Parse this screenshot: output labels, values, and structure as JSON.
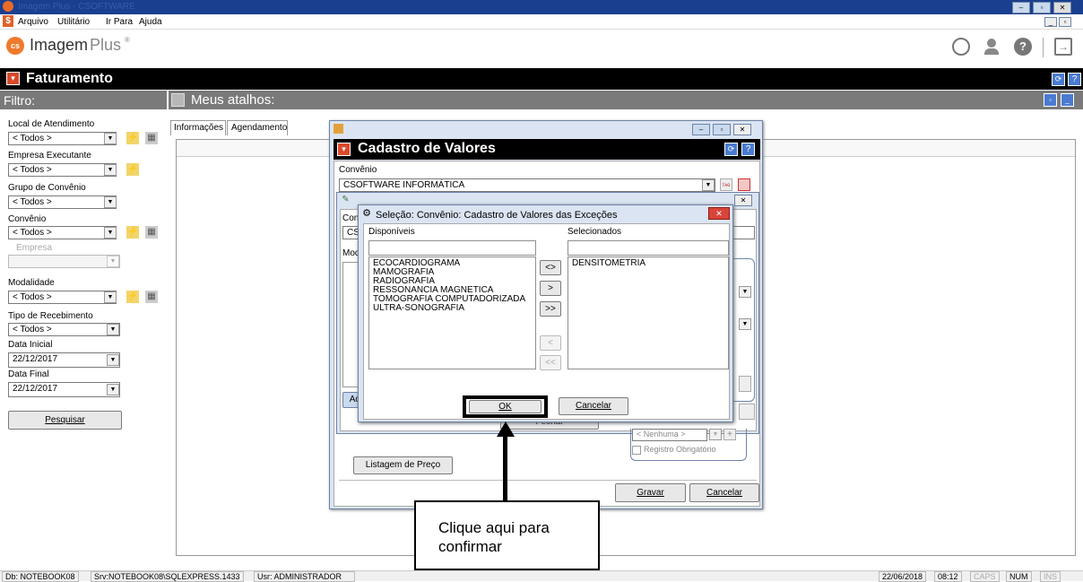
{
  "window_title": "Imagem Plus - CSOFTWARE",
  "menu": {
    "items": [
      "Arquivo",
      "Utilitário",
      "Ir Para",
      "Ajuda"
    ]
  },
  "brand": {
    "name_a": "Imagem",
    "name_b": "Plus",
    "reg": "®",
    "mark": "cs"
  },
  "module": {
    "title": "Faturamento"
  },
  "filter": {
    "title": "Filtro:",
    "local_label": "Local de Atendimento",
    "local_value": "< Todos >",
    "empresa_exec_label": "Empresa Executante",
    "empresa_exec_value": "< Todos >",
    "grupo_label": "Grupo de Convênio",
    "grupo_value": "< Todos >",
    "convenio_label": "Convênio",
    "convenio_value": "< Todos >",
    "empresa_label": "Empresa",
    "empresa_value": "",
    "modalidade_label": "Modalidade",
    "modalidade_value": "< Todos >",
    "tipo_label": "Tipo de Recebimento",
    "tipo_value": "< Todos >",
    "data_inicial_label": "Data Inicial",
    "data_inicial_value": "22/12/2017",
    "data_final_label": "Data Final",
    "data_final_value": "22/12/2017",
    "pesquisar": "Pesquisar"
  },
  "shortcuts": {
    "title": "Meus atalhos:",
    "tab_info": "Informações",
    "tab_agenda": "Agendamento"
  },
  "cadastro": {
    "title": "Cadastro de Valores",
    "convenio_label": "Convênio",
    "convenio_value": "CSOFTWARE INFORMÁTICA",
    "inner_conv_label": "Conv",
    "inner_conv_value": "CSO",
    "inner_moda_label": "Moda",
    "add_label": "Adi",
    "fechar": "Fechar",
    "nenhuma": "< Nenhuma >",
    "registro_obrigatorio": "Registro Obrigatório",
    "listagem": "Listagem de Preço",
    "gravar": "Gravar",
    "cancelar": "Cancelar"
  },
  "selecao": {
    "title": "Seleção: Convênio: Cadastro de Valores das Exceções",
    "disponiveis_label": "Disponíveis",
    "selecionados_label": "Selecionados",
    "disponiveis": [
      "ECOCARDIOGRAMA",
      "MAMOGRAFIA",
      "RADIOGRAFIA",
      "RESSONANCIA MAGNETICA",
      "TOMOGRAFIA COMPUTADORIZADA",
      "ULTRA-SONOGRAFIA"
    ],
    "selecionados": [
      "DENSITOMETRIA"
    ],
    "btn_swap": "<>",
    "btn_add": ">",
    "btn_add_all": ">>",
    "btn_remove": "<",
    "btn_remove_all": "<<",
    "ok": "OK",
    "cancelar": "Cancelar"
  },
  "callout": {
    "text": "Clique aqui para confirmar"
  },
  "status": {
    "db": "Db: NOTEBOOK08",
    "srv": "Srv:NOTEBOOK08\\SQLEXPRESS.1433",
    "usr": "Usr: ADMINISTRADOR",
    "date": "22/06/2018",
    "time": "08:12",
    "caps": "CAPS",
    "num": "NUM",
    "ins": "INS"
  },
  "colors": {
    "titlebar": "#1a3f8f",
    "accent": "#d94a2c",
    "ok_highlight": "#000000"
  }
}
